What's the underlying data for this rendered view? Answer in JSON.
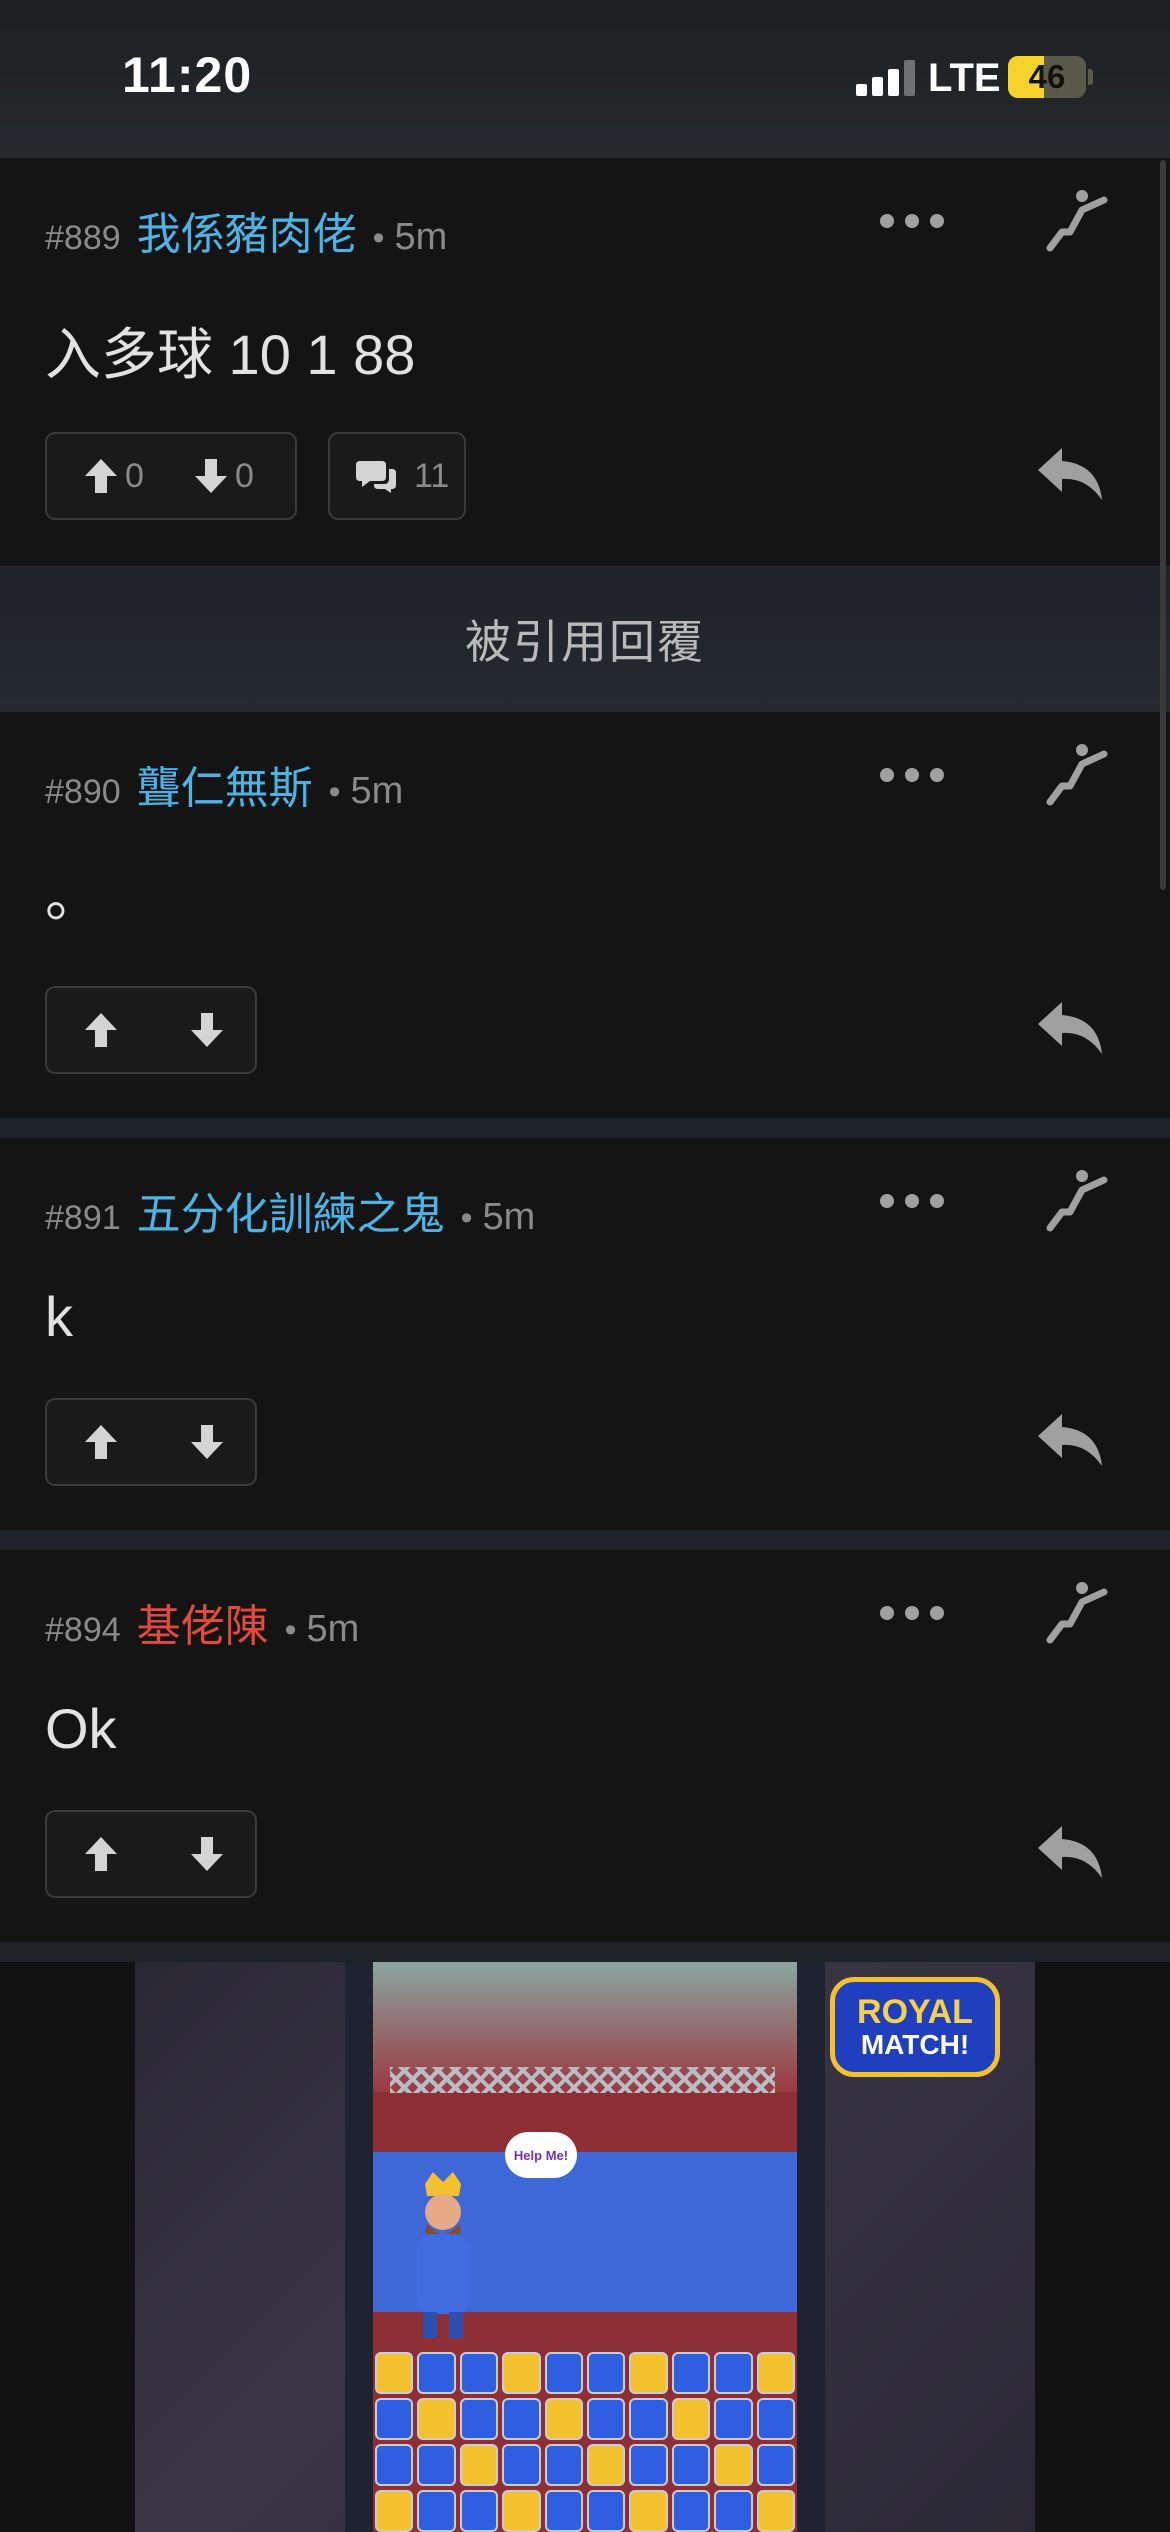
{
  "status_bar": {
    "time": "11:20",
    "network": "LTE",
    "battery_level": "46",
    "battery_fraction": 0.46,
    "battery_color": "#f6d22c"
  },
  "posts": [
    {
      "number": "#889",
      "author": "我係豬肉佬",
      "separator": "•",
      "time": "5m",
      "content": "入多球 10 1 88",
      "upvotes": "0",
      "downvotes": "0",
      "comments": "11",
      "author_color": "#4cb3e6"
    },
    {
      "number": "#890",
      "author": "聾仁無斯",
      "separator": "•",
      "time": "5m",
      "content": "。",
      "author_color": "#4cb3e6"
    },
    {
      "number": "#891",
      "author": "五分化訓練之鬼",
      "separator": "•",
      "time": "5m",
      "content": "k",
      "author_color": "#4cb3e6"
    },
    {
      "number": "#894",
      "author": "基佬陳",
      "separator": "•",
      "time": "5m",
      "content": "Ok",
      "author_color": "#e14a3c"
    }
  ],
  "quoted_replies_label": "被引用回覆",
  "ad": {
    "logo_line1": "ROYAL",
    "logo_line2": "MATCH!",
    "bubble_text": "Help Me!"
  },
  "icons": {
    "more": "more-dots-icon",
    "jump": "jump-to-post-icon",
    "upvote": "arrow-up-icon",
    "downvote": "arrow-down-icon",
    "comment": "comment-bubbles-icon",
    "reply": "reply-arrow-icon"
  }
}
